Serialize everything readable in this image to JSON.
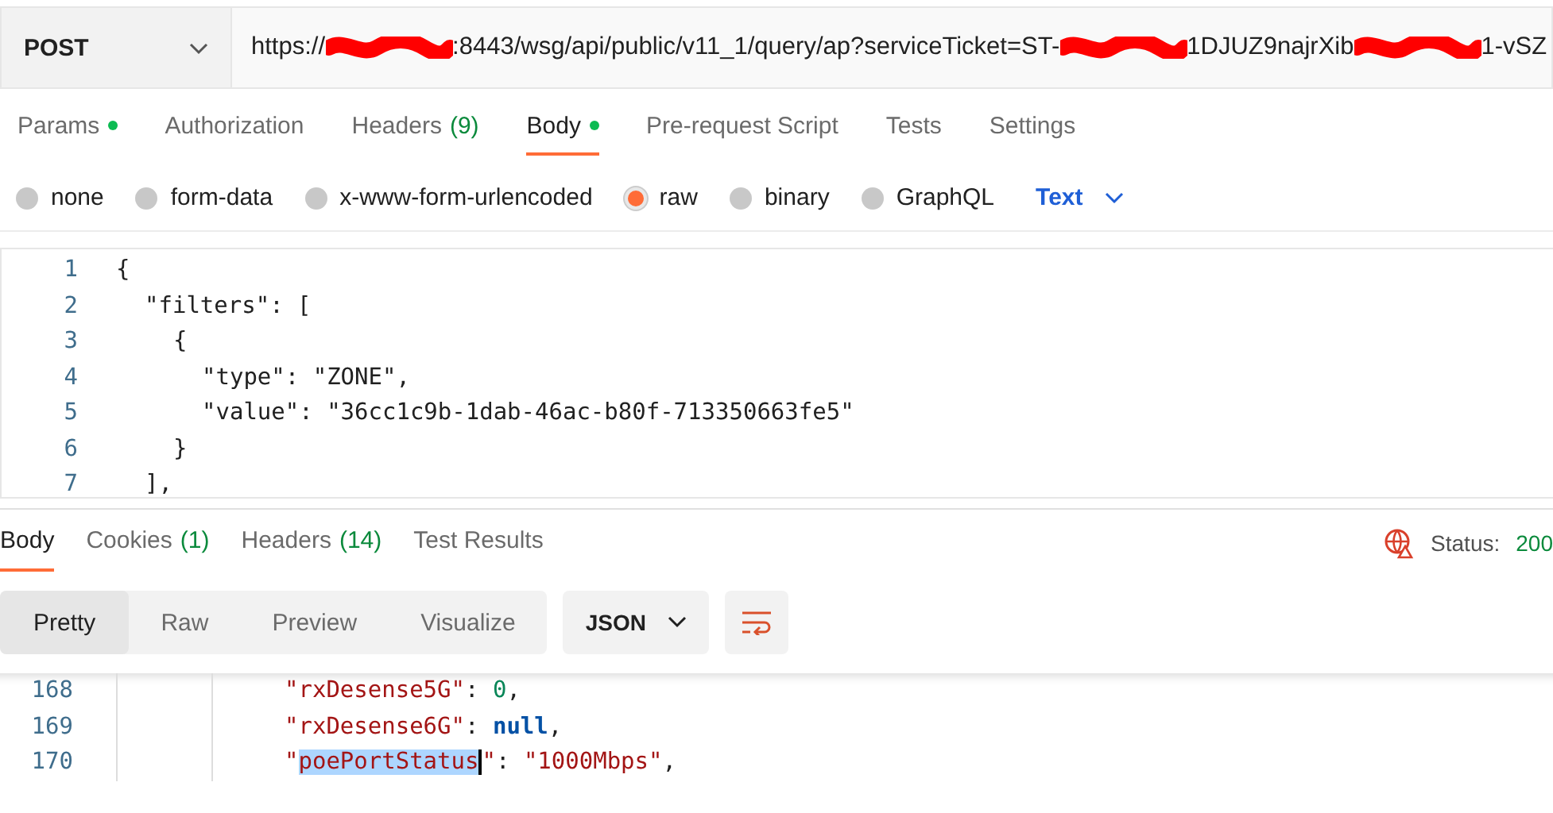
{
  "request": {
    "method": "POST",
    "url": [
      {
        "kind": "text",
        "text": "https://"
      },
      {
        "kind": "redacted"
      },
      {
        "kind": "text",
        "text": ":8443/wsg/api/public/v11_1/query/ap?serviceTicket=ST-"
      },
      {
        "kind": "redacted"
      },
      {
        "kind": "text",
        "text": "1DJUZ9najrXib"
      },
      {
        "kind": "redacted"
      },
      {
        "kind": "text",
        "text": "1-vSZ"
      }
    ]
  },
  "request_tabs": [
    {
      "label": "Params",
      "dot": true,
      "selected": false
    },
    {
      "label": "Authorization",
      "selected": false
    },
    {
      "label": "Headers",
      "count": "(9)",
      "selected": false
    },
    {
      "label": "Body",
      "dot": true,
      "selected": true
    },
    {
      "label": "Pre-request Script",
      "selected": false
    },
    {
      "label": "Tests",
      "selected": false
    },
    {
      "label": "Settings",
      "selected": false
    }
  ],
  "body_types": [
    {
      "label": "none",
      "selected": false
    },
    {
      "label": "form-data",
      "selected": false
    },
    {
      "label": "x-www-form-urlencoded",
      "selected": false
    },
    {
      "label": "raw",
      "selected": true
    },
    {
      "label": "binary",
      "selected": false
    },
    {
      "label": "GraphQL",
      "selected": false
    }
  ],
  "format": "Text",
  "editor_lines": [
    {
      "number": "1",
      "code": "{",
      "children": [
        {
          "number": "2",
          "code": "\"filters\": [",
          "children": [
            {
              "number": "3",
              "code": "{",
              "children": [
                {
                  "number": "4",
                  "code": "\"type\": \"ZONE\","
                },
                {
                  "number": "5",
                  "code": "\"value\": \"36cc1c9b-1dab-46ac-b80f-713350663fe5\""
                }
              ]
            },
            {
              "number": "6",
              "code": "}"
            }
          ]
        },
        {
          "number": "7",
          "code": "],"
        }
      ]
    }
  ],
  "response_tabs": [
    {
      "label": "Body",
      "selected": true
    },
    {
      "label": "Cookies",
      "count": "(1)",
      "selected": false
    },
    {
      "label": "Headers",
      "count": "(14)",
      "selected": false
    },
    {
      "label": "Test Results",
      "selected": false
    }
  ],
  "status": {
    "label": "Status:",
    "value": "200"
  },
  "view_modes": [
    {
      "label": "Pretty",
      "selected": true
    },
    {
      "label": "Raw",
      "selected": false
    },
    {
      "label": "Preview",
      "selected": false
    },
    {
      "label": "Visualize",
      "selected": false
    }
  ],
  "response_format": "JSON",
  "response_lines": [
    {
      "number": "168",
      "selected": false,
      "tokens": [
        {
          "kind": "key",
          "text": "\"rxDesense5G\""
        },
        {
          "kind": "punct",
          "text": ": "
        },
        {
          "kind": "number",
          "text": "0"
        },
        {
          "kind": "punct",
          "text": ","
        }
      ]
    },
    {
      "number": "169",
      "selected": false,
      "tokens": [
        {
          "kind": "key",
          "text": "\"rxDesense6G\""
        },
        {
          "kind": "punct",
          "text": ": "
        },
        {
          "kind": "null",
          "text": "null"
        },
        {
          "kind": "punct",
          "text": ","
        }
      ]
    },
    {
      "number": "170",
      "selected": true,
      "tokens": [
        {
          "kind": "quote",
          "text": "\""
        },
        {
          "kind": "key",
          "text": "poePortStatus"
        },
        {
          "kind": "quote",
          "text": "\""
        },
        {
          "kind": "punct",
          "text": ": "
        },
        {
          "kind": "string",
          "text": "\"1000Mbps\""
        },
        {
          "kind": "punct",
          "text": ","
        }
      ]
    }
  ]
}
